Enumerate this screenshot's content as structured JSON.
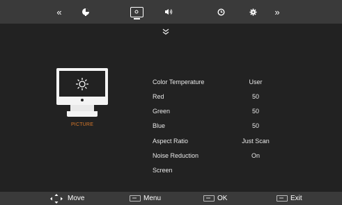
{
  "top_tabs": [
    {
      "icon": "double-chevron-left-icon",
      "glyph": "«"
    },
    {
      "icon": "picture-mode-icon",
      "glyph": "●"
    },
    {
      "icon": "picture-icon",
      "glyph": "",
      "active": true
    },
    {
      "icon": "speaker-icon",
      "glyph": "◀)"
    },
    {
      "icon": "clock-icon",
      "glyph": "⊙"
    },
    {
      "icon": "gear-icon",
      "glyph": "✱"
    },
    {
      "icon": "double-chevron-right-icon",
      "glyph": "»"
    }
  ],
  "category_label": "PICTURE",
  "settings": [
    {
      "label": "Color Temperature",
      "value": "User"
    },
    {
      "label": "Red",
      "value": "50"
    },
    {
      "label": "Green",
      "value": "50"
    },
    {
      "label": "Blue",
      "value": "50"
    },
    {
      "label": "Aspect Ratio",
      "value": "Just Scan"
    },
    {
      "label": "Noise Reduction",
      "value": "On"
    },
    {
      "label": "Screen",
      "value": ""
    }
  ],
  "footer": {
    "move_label": "Move",
    "menu_label": "Menu",
    "ok_label": "OK",
    "exit_label": "Exit"
  },
  "colors": {
    "background": "#222222",
    "bar": "#3a3a3a",
    "accent": "#d9782a"
  }
}
